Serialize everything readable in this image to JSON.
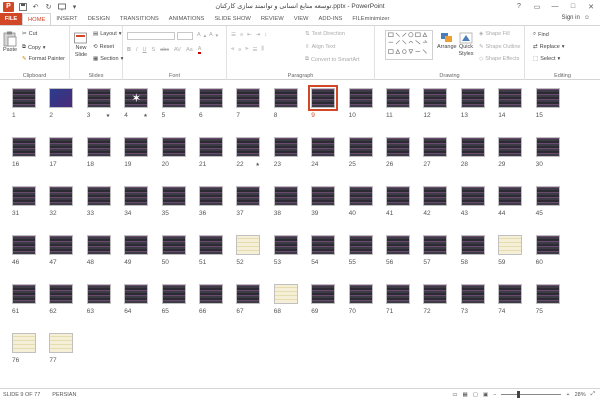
{
  "titlebar": {
    "title": "توسعه منابع انسانی و توانمند سازی کارکنان.pptx - PowerPoint",
    "app_icon": "P",
    "controls": [
      "?",
      "▭",
      "—",
      "□",
      "✕"
    ]
  },
  "tabs": {
    "file": "FILE",
    "items": [
      "HOME",
      "INSERT",
      "DESIGN",
      "TRANSITIONS",
      "ANIMATIONS",
      "SLIDE SHOW",
      "REVIEW",
      "VIEW",
      "ADD-INS",
      "FILEminimizer"
    ],
    "active": "HOME",
    "signin": "Sign in"
  },
  "ribbon": {
    "clipboard": {
      "paste": "Paste",
      "cut": "Cut",
      "copy": "Copy",
      "format_painter": "Format Painter",
      "label": "Clipboard"
    },
    "slides": {
      "new_slide": "New Slide",
      "layout": "Layout",
      "reset": "Reset",
      "section": "Section",
      "label": "Slides"
    },
    "font": {
      "label": "Font",
      "font_name": "",
      "font_size": ""
    },
    "paragraph": {
      "text_direction": "Text Direction",
      "align_text": "Align Text",
      "smartart": "Convert to SmartArt",
      "label": "Paragraph"
    },
    "drawing": {
      "arrange": "Arrange",
      "quick_styles": "Quick Styles",
      "shape_fill": "Shape Fill",
      "shape_outline": "Shape Outline",
      "shape_effects": "Shape Effects",
      "label": "Drawing"
    },
    "editing": {
      "find": "Find",
      "replace": "Replace",
      "select": "Select",
      "label": "Editing"
    }
  },
  "slides": {
    "total": 77,
    "selected": 9,
    "star_slides": [
      3,
      4,
      22
    ],
    "light_slides": [
      52,
      59,
      68,
      76,
      77
    ],
    "blue_slides": [
      2
    ],
    "white_star_slides": [
      4
    ]
  },
  "statusbar": {
    "slide_info": "SLIDE 9 OF 77",
    "language": "PERSIAN",
    "zoom": "28%",
    "zoom_minus": "−",
    "zoom_plus": "+"
  }
}
